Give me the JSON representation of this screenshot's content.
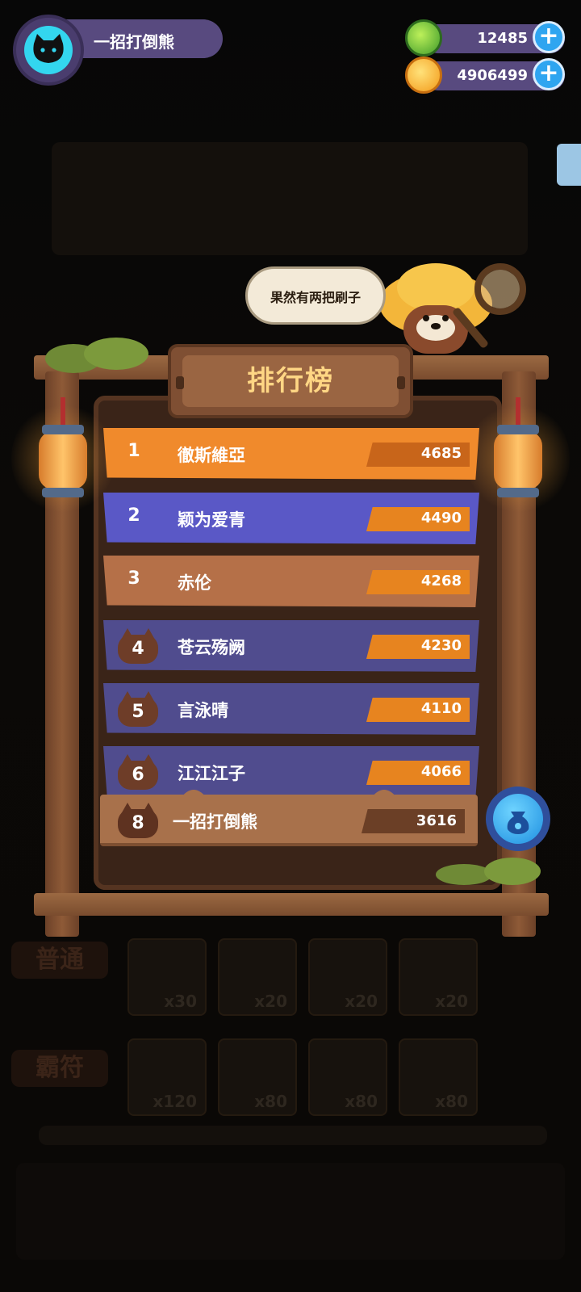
{
  "player": {
    "name": "一招打倒熊",
    "avatar_icon": "cat-avatar-icon"
  },
  "currencies": [
    {
      "name": "green-gem",
      "value": "12485",
      "add_label": "+"
    },
    {
      "name": "gold-coin",
      "value": "4906499",
      "add_label": "+"
    }
  ],
  "speech_bubble": "果然有两把刷子",
  "leaderboard": {
    "title": "排行榜",
    "rows": [
      {
        "rank": "1",
        "name": "徹斯維亞",
        "score": "4685",
        "color": "#f08a2c",
        "tag_color": "#c8651a"
      },
      {
        "rank": "2",
        "name": "颖为爱青",
        "score": "4490",
        "color": "#5a58c6",
        "tag_color": "#e7841f"
      },
      {
        "rank": "3",
        "name": "赤伦",
        "score": "4268",
        "color": "#b57048",
        "tag_color": "#e7841f"
      },
      {
        "rank": "4",
        "name": "苍云殇阙",
        "score": "4230",
        "color": "#504c8e",
        "tag_color": "#e7841f"
      },
      {
        "rank": "5",
        "name": "言泳晴",
        "score": "4110",
        "color": "#504c8e",
        "tag_color": "#e7841f"
      },
      {
        "rank": "6",
        "name": "江江江子",
        "score": "4066",
        "color": "#504c8e",
        "tag_color": "#e7841f"
      }
    ],
    "my_row": {
      "rank": "8",
      "name": "一招打倒熊",
      "score": "3616"
    }
  },
  "background": {
    "labels": [
      "普通",
      "霸符"
    ],
    "row1_counts": [
      "x30",
      "x20",
      "x20",
      "x20"
    ],
    "row2_counts": [
      "x120",
      "x80",
      "x80",
      "x80"
    ]
  }
}
